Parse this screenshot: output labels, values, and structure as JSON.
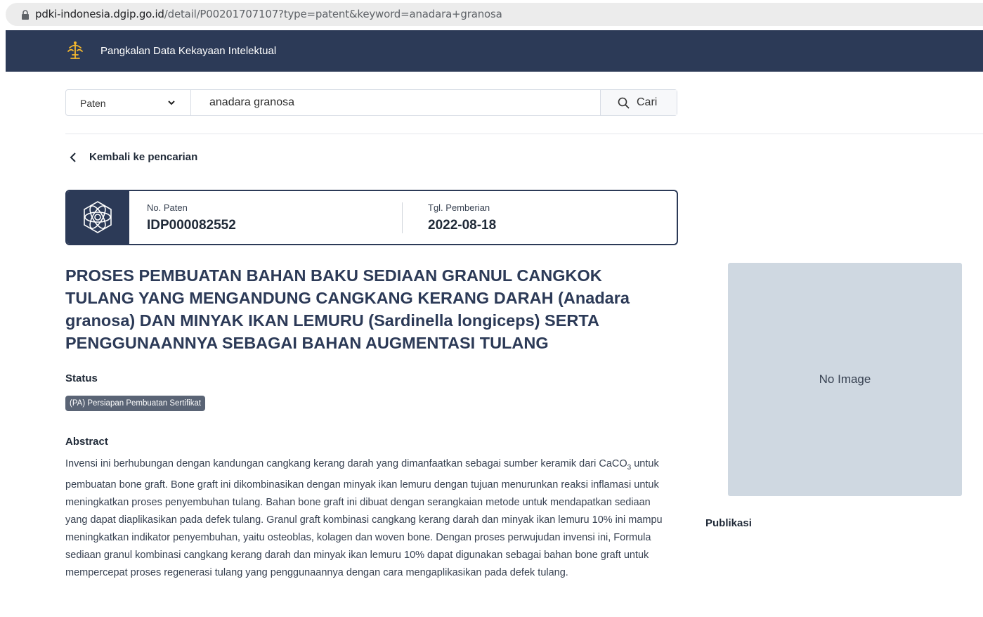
{
  "browser": {
    "url_domain": "pdki-indonesia.dgip.go.id",
    "url_path": "/detail/P00201707107?type=patent&keyword=anadara+granosa"
  },
  "navbar": {
    "logo_icon": "dgip-logo-icon",
    "title": "Pangkalan Data Kekayaan Intelektual"
  },
  "search": {
    "type_selected": "Paten",
    "query": "anadara granosa",
    "button_label": "Cari"
  },
  "back_link": "Kembali ke pencarian",
  "patent_card": {
    "icon": "atom-icon",
    "no_paten_label": "No. Paten",
    "no_paten_value": "IDP000082552",
    "tgl_label": "Tgl. Pemberian",
    "tgl_value": "2022-08-18"
  },
  "title": "PROSES PEMBUATAN BAHAN BAKU SEDIAAN GRANUL CANGKOK TULANG YANG MENGANDUNG CANGKANG KERANG DARAH (Anadara granosa) DAN MINYAK IKAN LEMURU (Sardinella longiceps) SERTA PENGGUNAANNYA SEBAGAI BAHAN AUGMENTASI TULANG",
  "status": {
    "label": "Status",
    "badge": "(PA) Persiapan Pembuatan Sertifikat"
  },
  "abstract": {
    "label": "Abstract",
    "text_before_formula": "Invensi ini berhubungan dengan kandungan cangkang kerang darah yang dimanfaatkan sebagai sumber keramik dari CaCO",
    "formula_subscript": "3",
    "text_after_formula": " untuk pembuatan bone graft. Bone graft ini dikombinasikan dengan minyak ikan lemuru dengan tujuan menurunkan reaksi inflamasi untuk meningkatkan proses penyembuhan tulang. Bahan bone graft ini dibuat dengan serangkaian metode untuk mendapatkan sediaan yang dapat diaplikasikan pada defek tulang. Granul graft kombinasi cangkang kerang darah dan minyak ikan lemuru 10% ini mampu meningkatkan indikator penyembuhan, yaitu osteoblas, kolagen dan woven bone. Dengan proses perwujudan invensi ini, Formula sediaan granul kombinasi cangkang kerang darah dan minyak ikan lemuru 10% dapat digunakan sebagai bahan bone graft untuk mempercepat proses regenerasi tulang yang penggunaannya dengan cara mengaplikasikan pada defek tulang."
  },
  "image_panel": {
    "placeholder": "No Image"
  },
  "publikasi_label": "Publikasi",
  "colors": {
    "navbar": "#2c3a57",
    "badge": "#5a6475",
    "image_placeholder": "#cfd8e1"
  }
}
